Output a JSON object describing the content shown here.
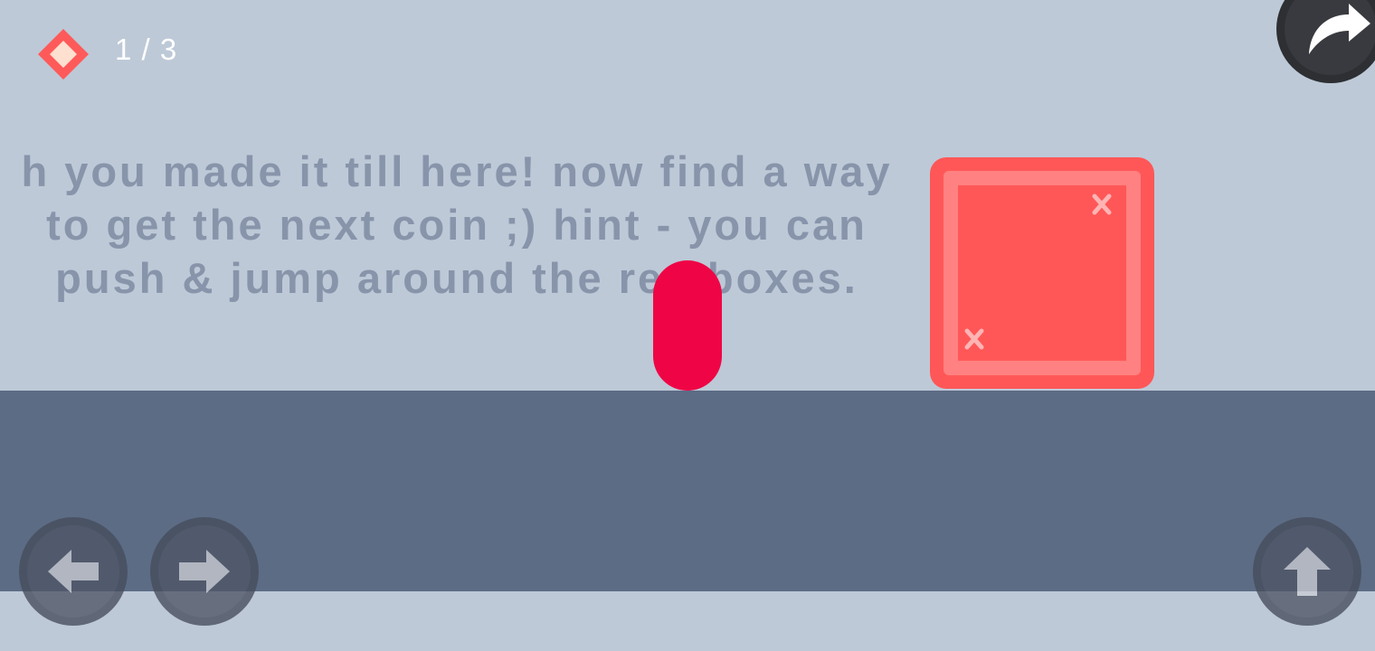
{
  "hud": {
    "coin_icon": "diamond-coin-icon",
    "coins_collected": 1,
    "coins_total": 3,
    "counter_text": "1 / 3"
  },
  "hint": {
    "text": "h you made it till here! now find a way\nto get the next coin ;) hint - you can\npush & jump around the red boxes."
  },
  "controls": {
    "left_icon": "arrow-left-icon",
    "right_icon": "arrow-right-icon",
    "jump_icon": "arrow-up-icon",
    "skip_icon": "redo-arrow-icon"
  },
  "colors": {
    "background": "#bdc9d7",
    "ground": "#5c6c85",
    "player": "#ef0545",
    "box": "#ff5757",
    "hint_text": "#8794aa",
    "coin": "#ff5a5a"
  }
}
